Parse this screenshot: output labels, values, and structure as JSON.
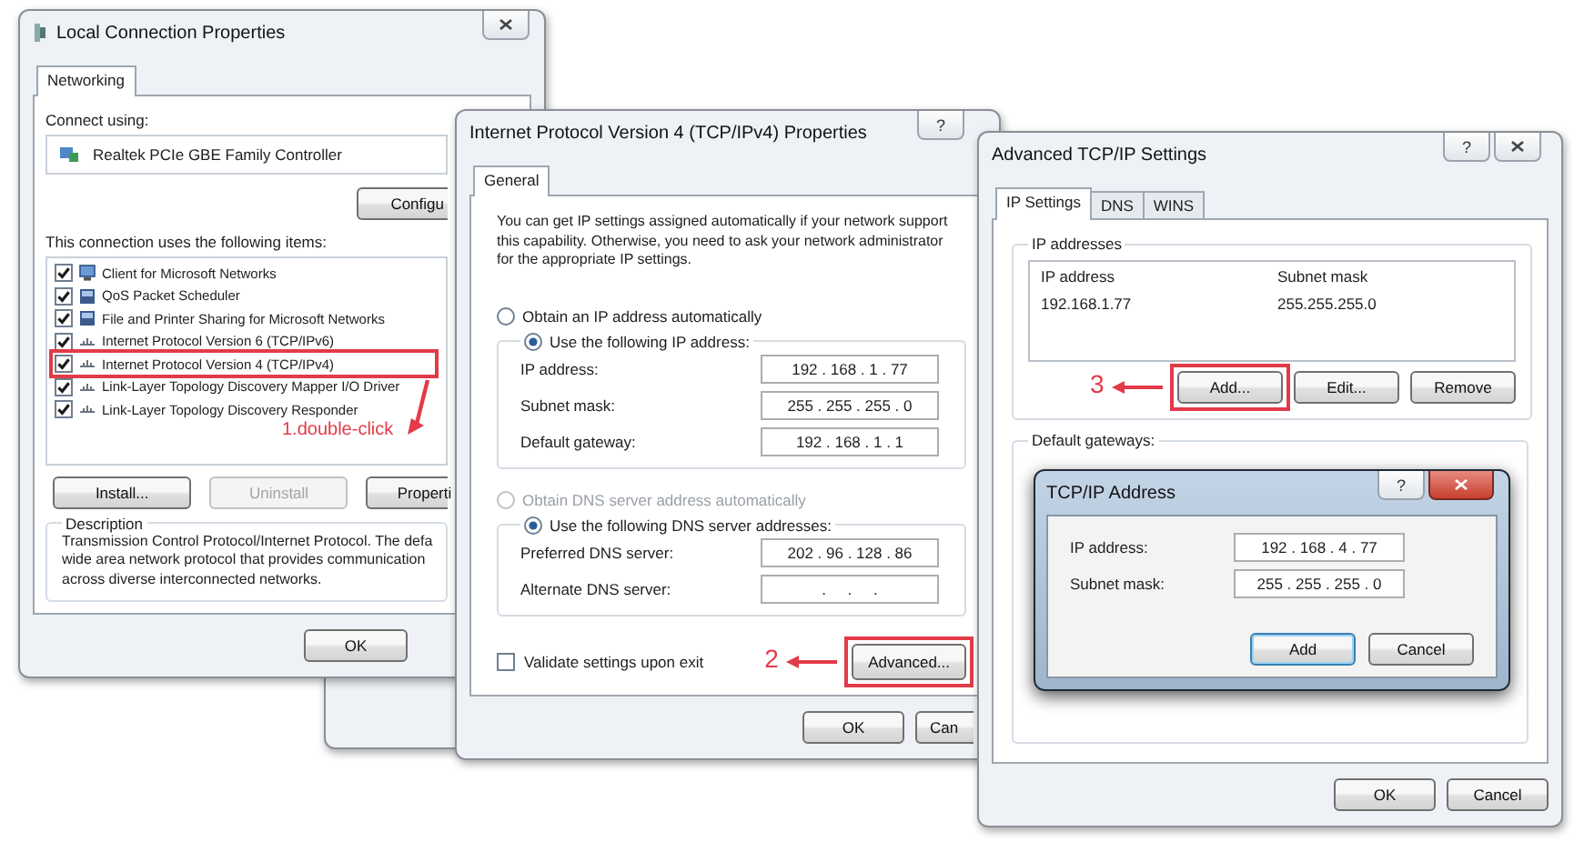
{
  "local_connection": {
    "title": "Local Connection Properties",
    "tabs": [
      {
        "label": "Networking",
        "selected": true
      }
    ],
    "connect_using_label": "Connect using:",
    "adapter": "Realtek PCIe GBE Family Controller",
    "configure_button": "Configu",
    "items_label": "This connection uses the following items:",
    "items": [
      {
        "label": "Client for Microsoft Networks",
        "checked": true,
        "kind": "client"
      },
      {
        "label": "QoS Packet Scheduler",
        "checked": true,
        "kind": "service"
      },
      {
        "label": "File and Printer Sharing for Microsoft Networks",
        "checked": true,
        "kind": "service"
      },
      {
        "label": "Internet Protocol Version 6 (TCP/IPv6)",
        "checked": true,
        "kind": "protocol"
      },
      {
        "label": "Internet Protocol Version 4 (TCP/IPv4)",
        "checked": true,
        "kind": "protocol"
      },
      {
        "label": "Link-Layer Topology Discovery Mapper I/O Driver",
        "checked": true,
        "kind": "protocol"
      },
      {
        "label": "Link-Layer Topology Discovery Responder",
        "checked": true,
        "kind": "protocol"
      }
    ],
    "buttons": [
      {
        "label": "Install...",
        "disabled": false
      },
      {
        "label": "Uninstall",
        "disabled": true
      },
      {
        "label": "Properti",
        "disabled": false
      }
    ],
    "description_label": "Description",
    "description": "Transmission Control Protocol/Internet Protocol. The defa\nwide area network protocol that provides communication\nacross diverse interconnected networks.",
    "ok_button": "OK"
  },
  "ipv4_properties": {
    "title": "Internet Protocol Version 4 (TCP/IPv4) Properties",
    "help_button": "?",
    "tabs": [
      {
        "label": "General",
        "selected": true
      }
    ],
    "intro": "You can get IP settings assigned automatically if your network support\nthis capability. Otherwise, you need to ask your network administrator\nfor the appropriate IP settings.",
    "ip_mode": [
      {
        "label": "Obtain an IP address automatically",
        "selected": false,
        "disabled": false
      },
      {
        "label": "Use the following IP address:",
        "selected": true,
        "disabled": false
      }
    ],
    "ip_fields": [
      {
        "label": "IP address:",
        "value": "192 . 168 . 1 . 77"
      },
      {
        "label": "Subnet mask:",
        "value": "255 . 255 . 255 . 0"
      },
      {
        "label": "Default gateway:",
        "value": "192 . 168 . 1 . 1"
      }
    ],
    "dns_mode": [
      {
        "label": "Obtain DNS server address automatically",
        "selected": false,
        "disabled": true
      },
      {
        "label": "Use the following DNS server addresses:",
        "selected": true,
        "disabled": false
      }
    ],
    "dns_fields": [
      {
        "label": "Preferred DNS server:",
        "value": "202 . 96 . 128 . 86"
      },
      {
        "label": "Alternate DNS server:",
        "value": ".     .     ."
      }
    ],
    "validate": {
      "label": "Validate settings upon exit",
      "checked": false
    },
    "advanced_button": "Advanced...",
    "ok_button": "OK",
    "cancel_button": "Can"
  },
  "advanced_tcpip": {
    "title": "Advanced TCP/IP Settings",
    "help_button": "?",
    "tabs": [
      {
        "label": "IP Settings",
        "selected": true
      },
      {
        "label": "DNS",
        "selected": false
      },
      {
        "label": "WINS",
        "selected": false
      }
    ],
    "ip_addresses_label": "IP addresses",
    "table": {
      "columns": [
        "IP address",
        "Subnet mask"
      ],
      "rows": [
        [
          "192.168.1.77",
          "255.255.255.0"
        ]
      ]
    },
    "buttons": [
      "Add...",
      "Edit...",
      "Remove"
    ],
    "gateways_label": "Default gateways:",
    "ok_button": "OK",
    "cancel_button": "Cancel"
  },
  "tcpip_address": {
    "title": "TCP/IP Address",
    "help_button": "?",
    "fields": [
      {
        "label": "IP address:",
        "value": "192 . 168 . 4 . 77"
      },
      {
        "label": "Subnet mask:",
        "value": "255 . 255 . 255 . 0"
      }
    ],
    "add_button": "Add",
    "cancel_button": "Cancel"
  },
  "annotations": [
    {
      "text": "1.double-click"
    },
    {
      "text": "2"
    },
    {
      "text": "3"
    }
  ]
}
